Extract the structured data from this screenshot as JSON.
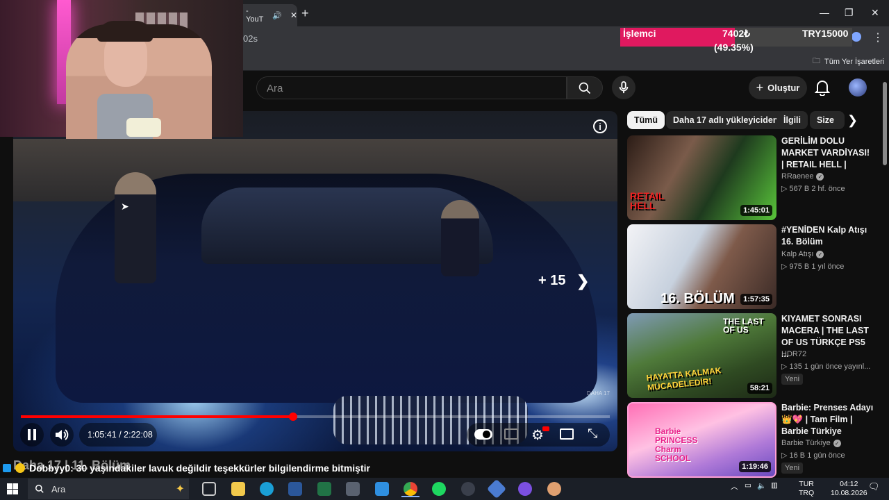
{
  "browser": {
    "tab_title": "- YouT",
    "new_tab_icon": "plus-icon",
    "url_fragment": "02s",
    "bookmarks_all": "Tüm Yer İşaretleri"
  },
  "donation": {
    "label": "İşlemci",
    "amount": "7402₺",
    "goal": "TRY15000",
    "percent_text": "(49.35%)",
    "progress_fraction": 0.4935,
    "fill_color": "#e0195f"
  },
  "youtube": {
    "search_placeholder": "Ara",
    "create_label": "Oluştur",
    "chips": [
      {
        "label": "Tümü",
        "active": true
      },
      {
        "label": "Daha 17 adlı yükleyiciden",
        "active": false
      },
      {
        "label": "İlgili",
        "active": false
      },
      {
        "label": "Size",
        "active": false
      }
    ],
    "player": {
      "current_time": "1:05:41",
      "separator": "/",
      "duration": "2:22:08",
      "progress_fraction": 0.4624,
      "skip_label": "+ 15",
      "watermark": "DAHA 17",
      "video_title": "Daha 17 | 11. Bölüm",
      "accent_color": "#ff0000"
    },
    "recommendations": [
      {
        "title": "GERİLİM DOLU MARKET VARDİYASI! | RETAIL HELL |",
        "channel": "RRaenee",
        "verified": true,
        "meta": "▷ 567 B  2 hf. önce",
        "duration": "1:45:01",
        "thumb_text": "RETAIL HELL",
        "badge": ""
      },
      {
        "title": "#YENİDEN Kalp Atışı 16. Bölüm",
        "channel": "Kalp Atışı",
        "verified": true,
        "meta": "▷ 975 B  1 yıl önce",
        "duration": "1:57:35",
        "thumb_text": "16. BÖLÜM",
        "badge": ""
      },
      {
        "title": "KIYAMET SONRASI MACERA | THE LAST OF US TÜRKÇE PS5 ...",
        "channel": "HDR72",
        "verified": false,
        "meta": "▷ 135  1 gün önce yayınl...",
        "duration": "58:21",
        "thumb_text": "HAYATTA KALMAK MÜCADELEDİR!",
        "thumb_text2": "THE LAST OF US",
        "badge": "Yeni"
      },
      {
        "title": "Barbie: Prenses Adayı 👑💖 | Tam Film | Barbie Türkiye",
        "channel": "Barbie Türkiye",
        "verified": true,
        "meta": "▷ 16 B  1 gün önce",
        "duration": "1:19:46",
        "thumb_text": "Barbie PRINCESS Charm SCHOOL",
        "badge": "Yeni"
      }
    ]
  },
  "chat": {
    "username": "Dobbyy0",
    "message": ": 30 yaşındakiler lavuk değildir teşekkürler bilgilendirme bitmiştir"
  },
  "taskbar": {
    "search_placeholder": "Ara",
    "language": "TUR",
    "layout": "TRQ",
    "time": "04:12",
    "date": "10.08.2026"
  }
}
